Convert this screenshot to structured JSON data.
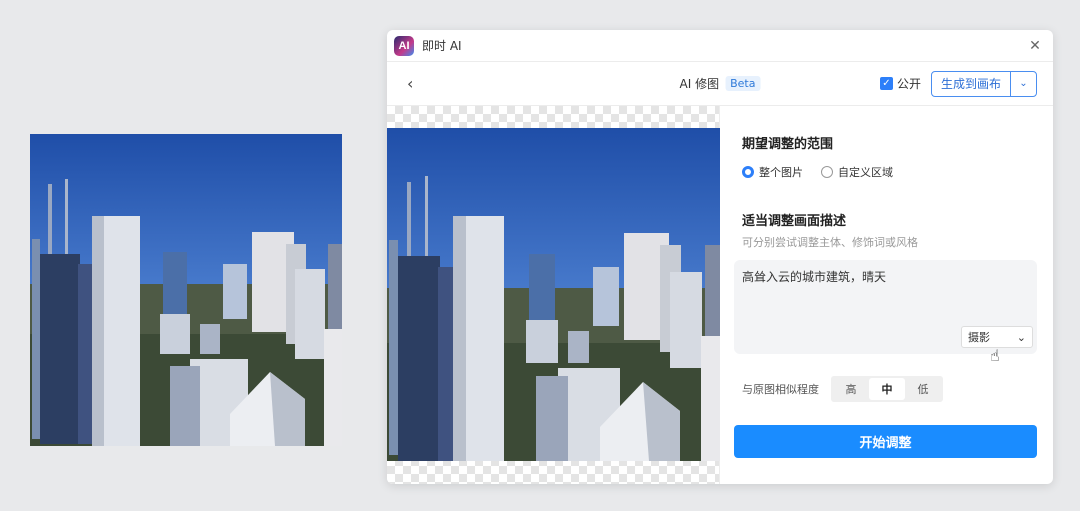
{
  "window": {
    "app_logo": "AI",
    "title": "即时 AI"
  },
  "toolbar": {
    "title": "AI 修图",
    "badge": "Beta",
    "public_label": "公开",
    "generate_label": "生成到画布"
  },
  "range": {
    "title": "期望调整的范围",
    "options": [
      "整个图片",
      "自定义区域"
    ],
    "selected": 0
  },
  "description": {
    "title": "适当调整画面描述",
    "hint": "可分别尝试调整主体、修饰词或风格",
    "value": "高耸入云的城市建筑，晴天",
    "style_value": "摄影"
  },
  "similarity": {
    "label": "与原图相似程度",
    "options": [
      "高",
      "中",
      "低"
    ],
    "selected": 1
  },
  "start_label": "开始调整",
  "colors": {
    "accent": "#1a8cff",
    "sky": "#2d5bb0"
  }
}
